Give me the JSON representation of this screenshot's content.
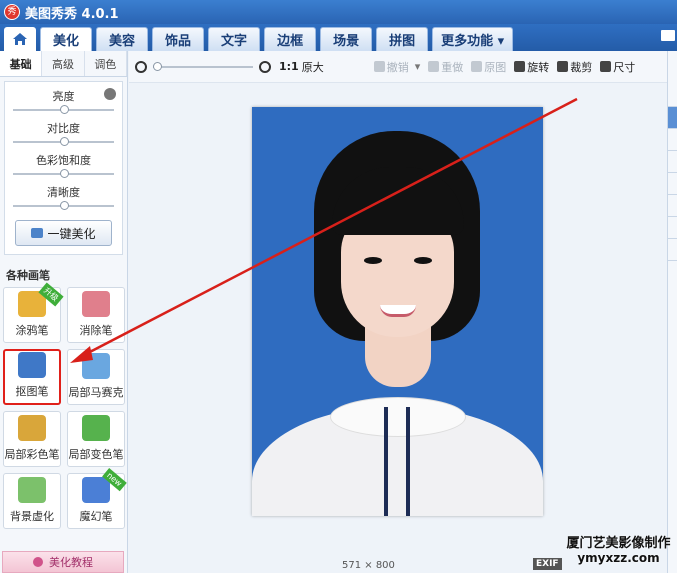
{
  "app": {
    "title": "美图秀秀 4.0.1",
    "logo_text": "秀"
  },
  "tabs": [
    "美化",
    "美容",
    "饰品",
    "文字",
    "边框",
    "场景",
    "拼图",
    "更多功能 ▾"
  ],
  "subtabs": [
    "基础",
    "高级",
    "调色"
  ],
  "sliders": [
    {
      "label": "亮度",
      "value": 0.5
    },
    {
      "label": "对比度",
      "value": 0.5
    },
    {
      "label": "色彩饱和度",
      "value": 0.5
    },
    {
      "label": "清晰度",
      "value": 0.5
    }
  ],
  "onekey_label": "一键美化",
  "brush_section_title": "各种画笔",
  "brushes": [
    {
      "label": "涂鸦笔",
      "badge": "升级",
      "icon": "pencil-icon",
      "color": "#e8b23a"
    },
    {
      "label": "消除笔",
      "badge": "",
      "icon": "eraser-icon",
      "color": "#e07f8c"
    },
    {
      "label": "抠图笔",
      "badge": "",
      "icon": "cutout-pen-icon",
      "color": "#3f78c7"
    },
    {
      "label": "局部马赛克",
      "badge": "",
      "icon": "mosaic-icon",
      "color": "#6aa7e0"
    },
    {
      "label": "局部彩色笔",
      "badge": "",
      "icon": "color-brush-icon",
      "color": "#d9a63a"
    },
    {
      "label": "局部变色笔",
      "badge": "",
      "icon": "recolor-icon",
      "color": "#56b24d"
    },
    {
      "label": "背景虚化",
      "badge": "",
      "icon": "background-blur-icon",
      "color": "#7cc16b"
    },
    {
      "label": "魔幻笔",
      "badge": "new",
      "icon": "magic-pen-icon",
      "color": "#4b7fd6"
    }
  ],
  "tutorial_label": "美化教程",
  "toolbar": {
    "ratio": "1:1",
    "original": "原大",
    "undo": "撤销",
    "redo": "重做",
    "reset": "原图",
    "rotate": "旋转",
    "crop": "裁剪",
    "size": "尺寸"
  },
  "image_size": "571 × 800",
  "exif": "EXIF",
  "watermark": {
    "line1": "厦门艺美影像制作",
    "line2": "ymyxzz.com"
  },
  "colors": {
    "accent": "#2a64b3",
    "highlight_red": "#e0201a",
    "photo_bg": "#2f6cc0"
  }
}
